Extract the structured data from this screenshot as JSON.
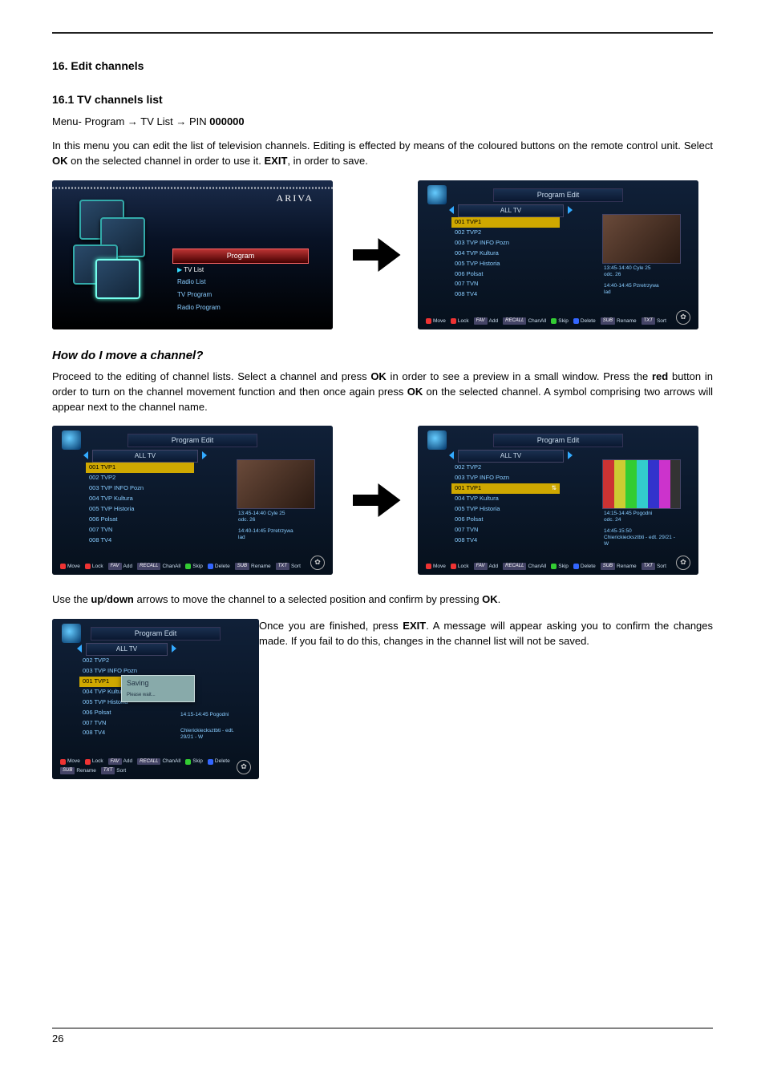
{
  "section_title": "16. Edit channels",
  "sub1_title": "16.1 TV channels list",
  "breadcrumb": {
    "pre": "Menu- Program → TV List → PIN ",
    "pin": "000000"
  },
  "para_intro_a": "In this menu you can edit the list of television channels. Editing is effected by means of the coloured buttons on the remote control unit. Select ",
  "para_intro_b": " on the selected channel in order to use it. ",
  "para_intro_c": ", in order to save.",
  "ok": "OK",
  "exit": "EXIT",
  "red": "red",
  "updown_up": "up",
  "updown_down": "down",
  "q_move": "How do I move a channel?",
  "para_move_a": "Proceed to the editing of channel lists. Select a channel and press ",
  "para_move_b": " in order to see a preview in a small window. Press the ",
  "para_move_c": " button in order to turn on the channel movement function and then once again press ",
  "para_move_d": " on the selected channel. A symbol comprising two arrows will appear next to the channel name.",
  "para_use_a": "Use the ",
  "para_use_b": "/",
  "para_use_c": " arrows to move the channel to a selected position and confirm by pressing ",
  "para_use_d": ".",
  "para_exit_a": "Once you are finished, press ",
  "para_exit_b": ". A message will appear asking you to confirm the changes made. If you fail to do this, changes in the channel list will not be saved.",
  "brand": "ARIVA",
  "menu_title": "Program",
  "menu_items": [
    "TV List",
    "Radio List",
    "TV Program",
    "Radio Program"
  ],
  "pe_title": "Program Edit",
  "pe_category": "ALL TV",
  "channels": [
    "001 TVP1",
    "002 TVP2",
    "003 TVP INFO Pozn",
    "004 TVP Kultura",
    "005 TVP Historia",
    "006 Polsat",
    "007 TVN",
    "008 TV4"
  ],
  "channels_moved": [
    "002 TVP2",
    "003 TVP INFO Pozn",
    "001 TVP1",
    "004 TVP Kultura",
    "005 TVP Historia",
    "006 Polsat",
    "007 TVN",
    "008 TV4"
  ],
  "move_icon": "⇅",
  "epg1": {
    "t": "13:45-14:40  Cyle 25",
    "s": "odc. 26"
  },
  "epg1b": {
    "t": "14:40-14:45  Pzretrzywa",
    "s": "lad"
  },
  "epg2": {
    "t": "14:15-14:45  Pogodni",
    "s": "odc. 24"
  },
  "epg2b": {
    "t": "14:45-15:50",
    "s": "Chierickiecksztbti - edt.\n29/21 - W"
  },
  "legend": {
    "move": "Move",
    "skip": "Skip",
    "lock": "Lock",
    "delete": "Delete",
    "add": "Add",
    "rename": "Rename",
    "chanall": "ChanAll",
    "sort": "Sort",
    "fav": "FAV",
    "recall": "RECALL"
  },
  "sat_icon": "✿",
  "saving": {
    "t": "Saving",
    "w": "Please wait..."
  },
  "page_number": "26"
}
